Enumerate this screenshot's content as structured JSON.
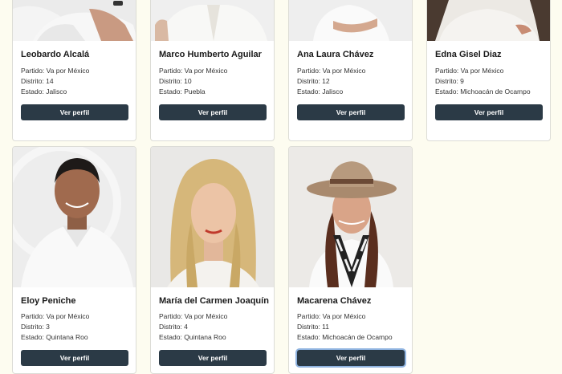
{
  "labels": {
    "party_prefix": "Partido: ",
    "district_prefix": "Distrito: ",
    "state_prefix": "Estado: "
  },
  "cards": [
    {
      "name": "Leobardo Alcalá",
      "party": "Va por México",
      "district": "14",
      "state": "Jalisco",
      "button": "Ver perfil",
      "photo": "photo-portrait"
    },
    {
      "name": "Marco Humberto Aguilar",
      "party": "Va por México",
      "district": "10",
      "state": "Puebla",
      "button": "Ver perfil",
      "photo": "photo-portrait"
    },
    {
      "name": "Ana Laura Chávez",
      "party": "Va por México",
      "district": "12",
      "state": "Jalisco",
      "button": "Ver perfil",
      "photo": "photo-portrait"
    },
    {
      "name": "Edna Gisel Diaz",
      "party": "Va por México",
      "district": "9",
      "state": "Michoacán de Ocampo",
      "button": "Ver perfil",
      "photo": "photo-portrait"
    },
    {
      "name": "Eloy Peniche",
      "party": "Va por México",
      "district": "3",
      "state": "Quintana Roo",
      "button": "Ver perfil",
      "photo": "photo-portrait"
    },
    {
      "name": "María del Carmen Joaquín",
      "party": "Va por México",
      "district": "4",
      "state": "Quintana Roo",
      "button": "Ver perfil",
      "photo": "photo-portrait"
    },
    {
      "name": "Macarena Chávez",
      "party": "Va por México",
      "district": "11",
      "state": "Michoacán de Ocampo",
      "button": "Ver perfil",
      "photo": "photo-portrait"
    }
  ],
  "colors": {
    "page_bg": "#fdfcf0",
    "button_bg": "#2b3a46",
    "button_text": "#ffffff"
  }
}
